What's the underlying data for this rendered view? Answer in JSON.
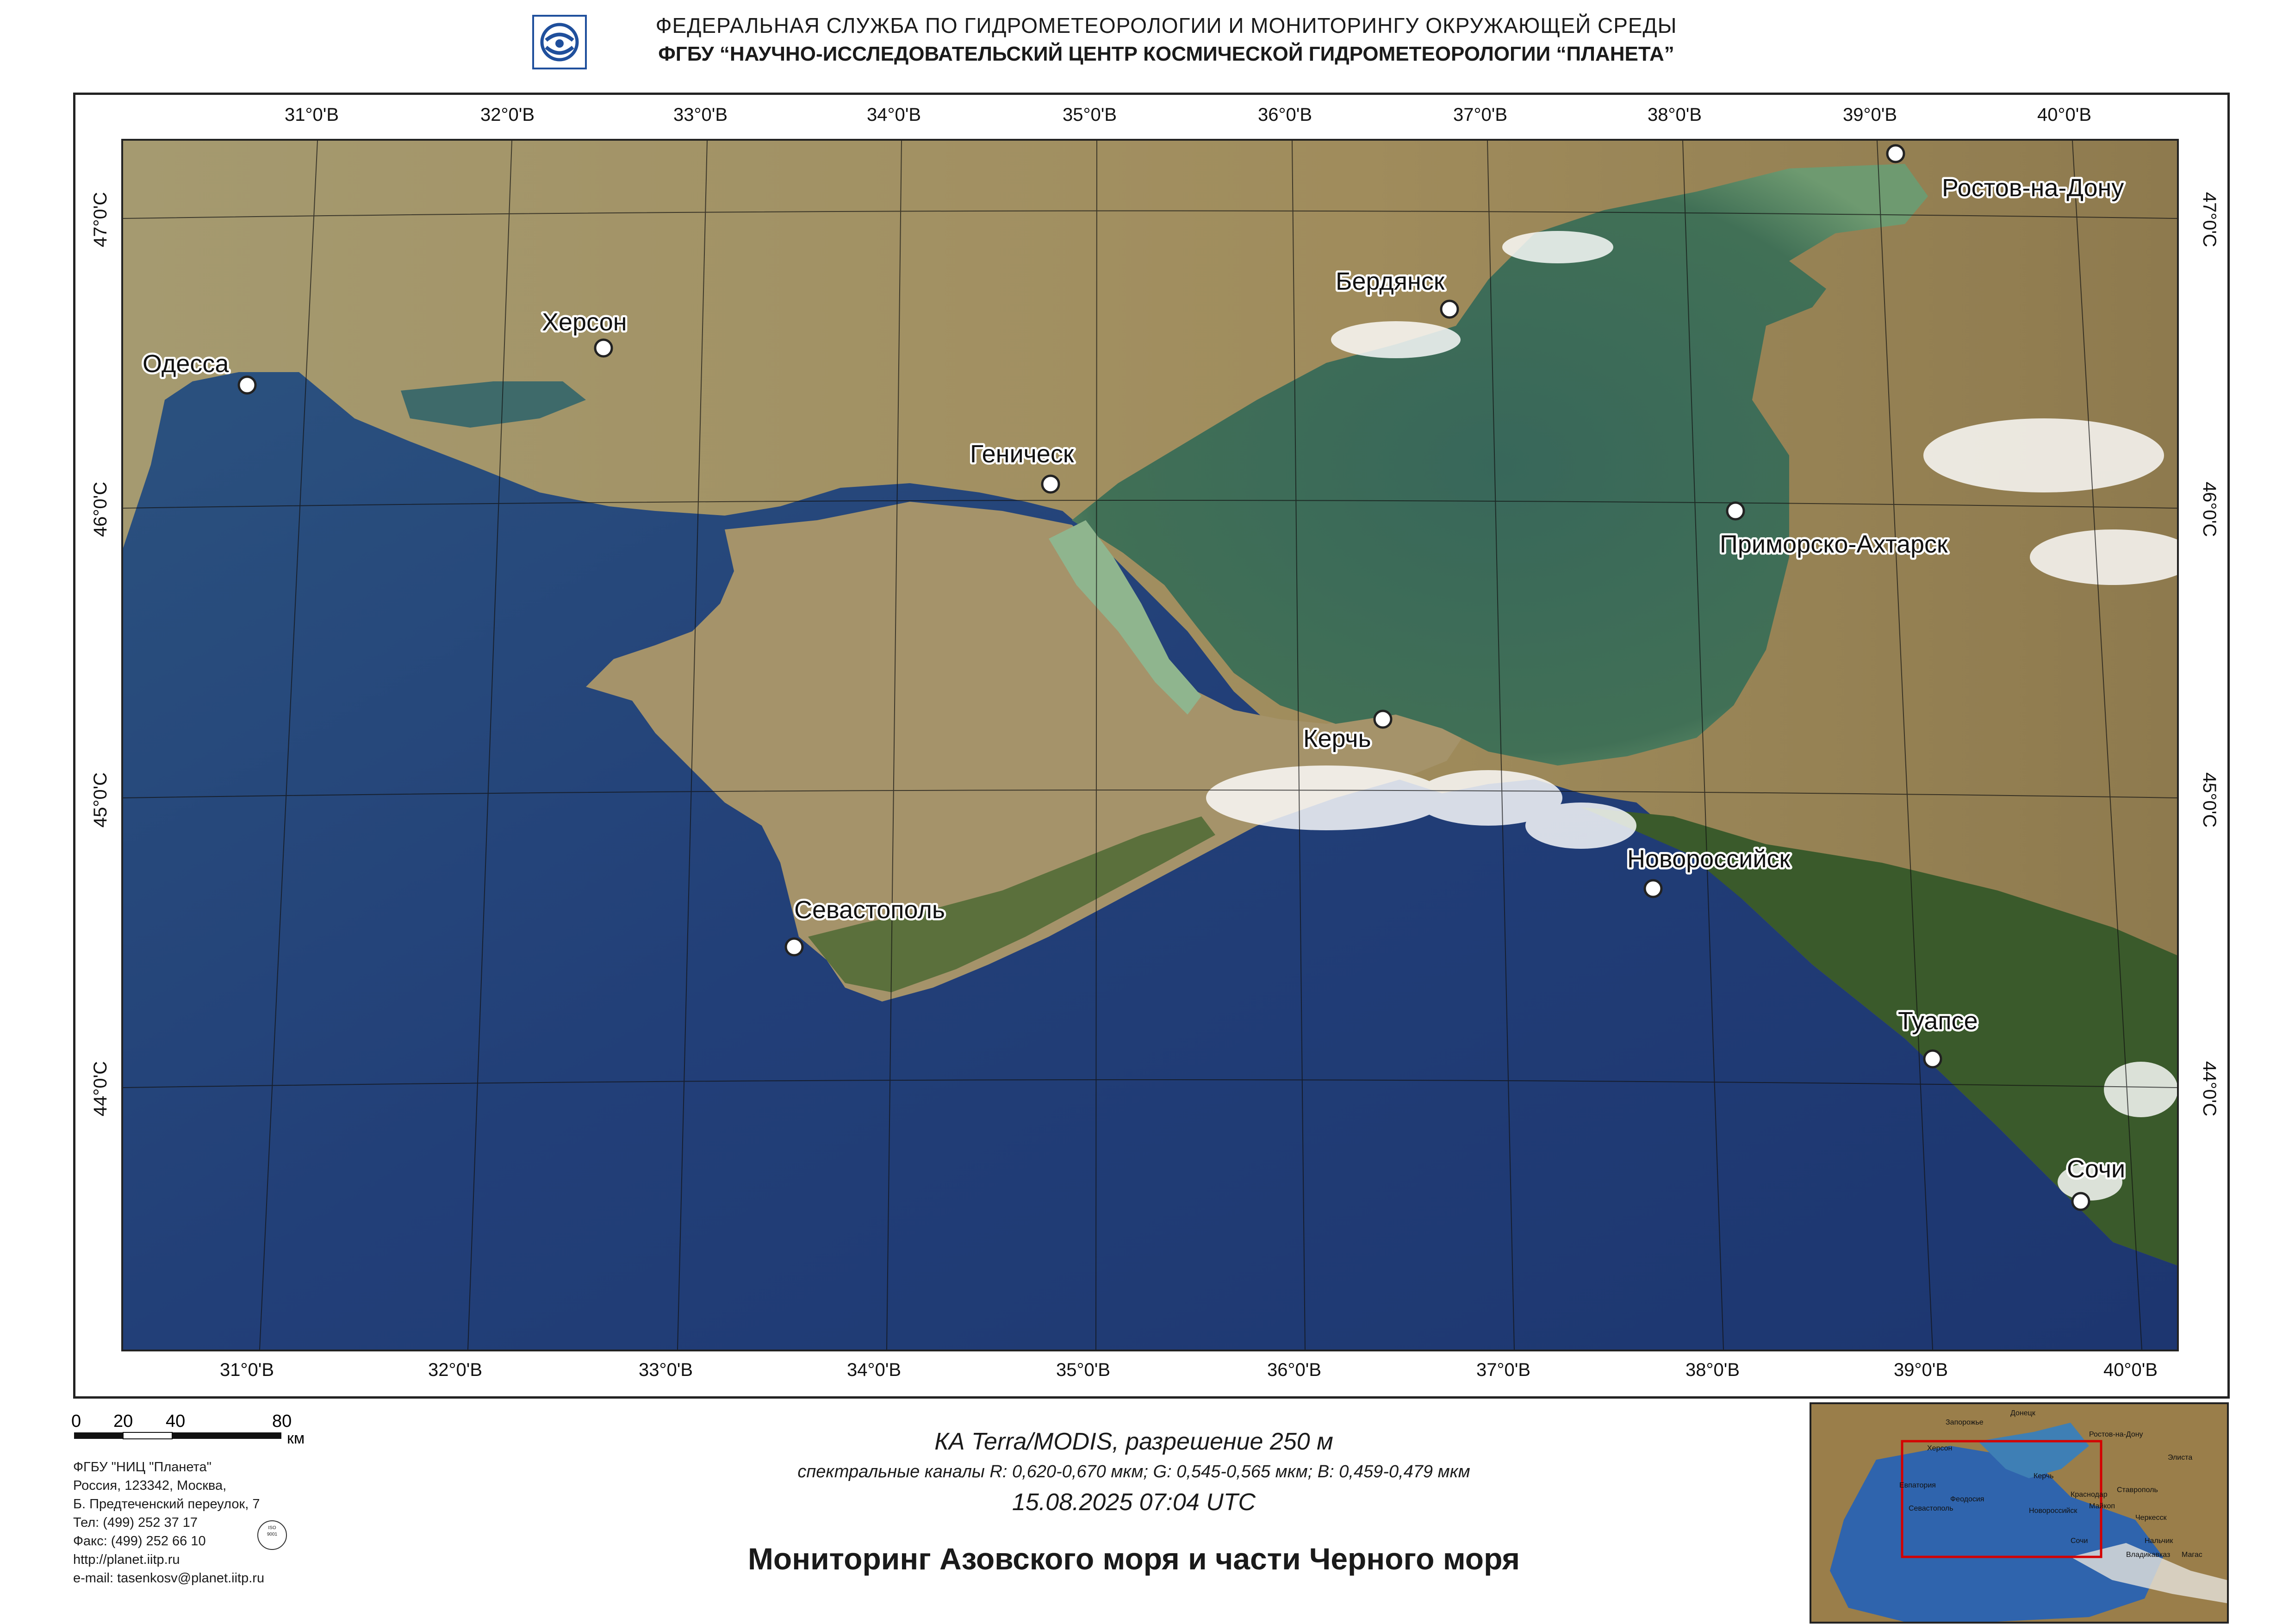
{
  "header": {
    "line1": "ФЕДЕРАЛЬНАЯ  СЛУЖБА  ПО ГИДРОМЕТЕОРОЛОГИИ И МОНИТОРИНГУ ОКРУЖАЮЩЕЙ СРЕДЫ",
    "line2": "ФГБУ “НАУЧНО-ИССЛЕДОВАТЕЛЬСКИЙ ЦЕНТР КОСМИЧЕСКОЙ ГИДРОМЕТЕОРОЛОГИИ “ПЛАНЕТА”"
  },
  "graticule": {
    "top_lon": [
      "31°0'В",
      "32°0'В",
      "33°0'В",
      "34°0'В",
      "35°0'В",
      "36°0'В",
      "37°0'В",
      "38°0'В",
      "39°0'В",
      "40°0'В"
    ],
    "bottom_lon": [
      "31°0'В",
      "32°0'В",
      "33°0'В",
      "34°0'В",
      "35°0'В",
      "36°0'В",
      "37°0'В",
      "38°0'В",
      "39°0'В",
      "40°0'В"
    ],
    "left_lat": [
      "47°0'С",
      "46°0'С",
      "45°0'С",
      "44°0'С"
    ],
    "right_lat": [
      "47°0'С",
      "46°0'С",
      "45°0'С",
      "44°0'С"
    ]
  },
  "cities": {
    "odessa": "Одесса",
    "kherson": "Херсон",
    "genichesk": "Геническ",
    "berdyansk": "Бердянск",
    "rostov": "Ростов-на-Дону",
    "primorsko": "Приморско-Ахтарск",
    "kerch": "Керчь",
    "novorossiysk": "Новороссийск",
    "sevastopol": "Севастополь",
    "tuapse": "Туапсе",
    "sochi": "Сочи"
  },
  "scale_bar": {
    "ticks": [
      "0",
      "20",
      "40",
      "80"
    ],
    "unit": "км"
  },
  "address": {
    "org": "ФГБУ \"НИЦ \"Планета\"",
    "line2": "Россия, 123342,  Москва,",
    "line3": "Б. Предтеченский переулок, 7",
    "phone": "Тел: (499) 252 37 17",
    "fax": "Факс: (499) 252 66 10",
    "site": "http://planet.iitp.ru",
    "email": "e-mail: tasenkosv@planet.iitp.ru"
  },
  "satellite": {
    "sensor": "КА Terra/MODIS, разрешение 250 м",
    "bands": "спектральные каналы R: 0,620-0,670 мкм; G: 0,545-0,565 мкм;  B: 0,459-0,479 мкм",
    "datetime": "15.08.2025   07:04 UTC"
  },
  "title": "Мониторинг Азовского моря и части Черного моря",
  "inset": {
    "labels": [
      "Запорожье",
      "Донецк",
      "Херсон",
      "Ростов-на-Дону",
      "Элиста",
      "Евпатория",
      "Керчь",
      "Краснодар",
      "Ставрополь",
      "Севастополь",
      "Феодосия",
      "Новороссийск",
      "Майкоп",
      "Черкесск",
      "Сочи",
      "Нальчик",
      "Владикавказ",
      "Магас"
    ]
  },
  "colors": {
    "sea": "#24477a",
    "azov": "#3f6c55",
    "land": "#a79566",
    "forest": "#3f5d2e",
    "inset_frame": "#d40000"
  }
}
